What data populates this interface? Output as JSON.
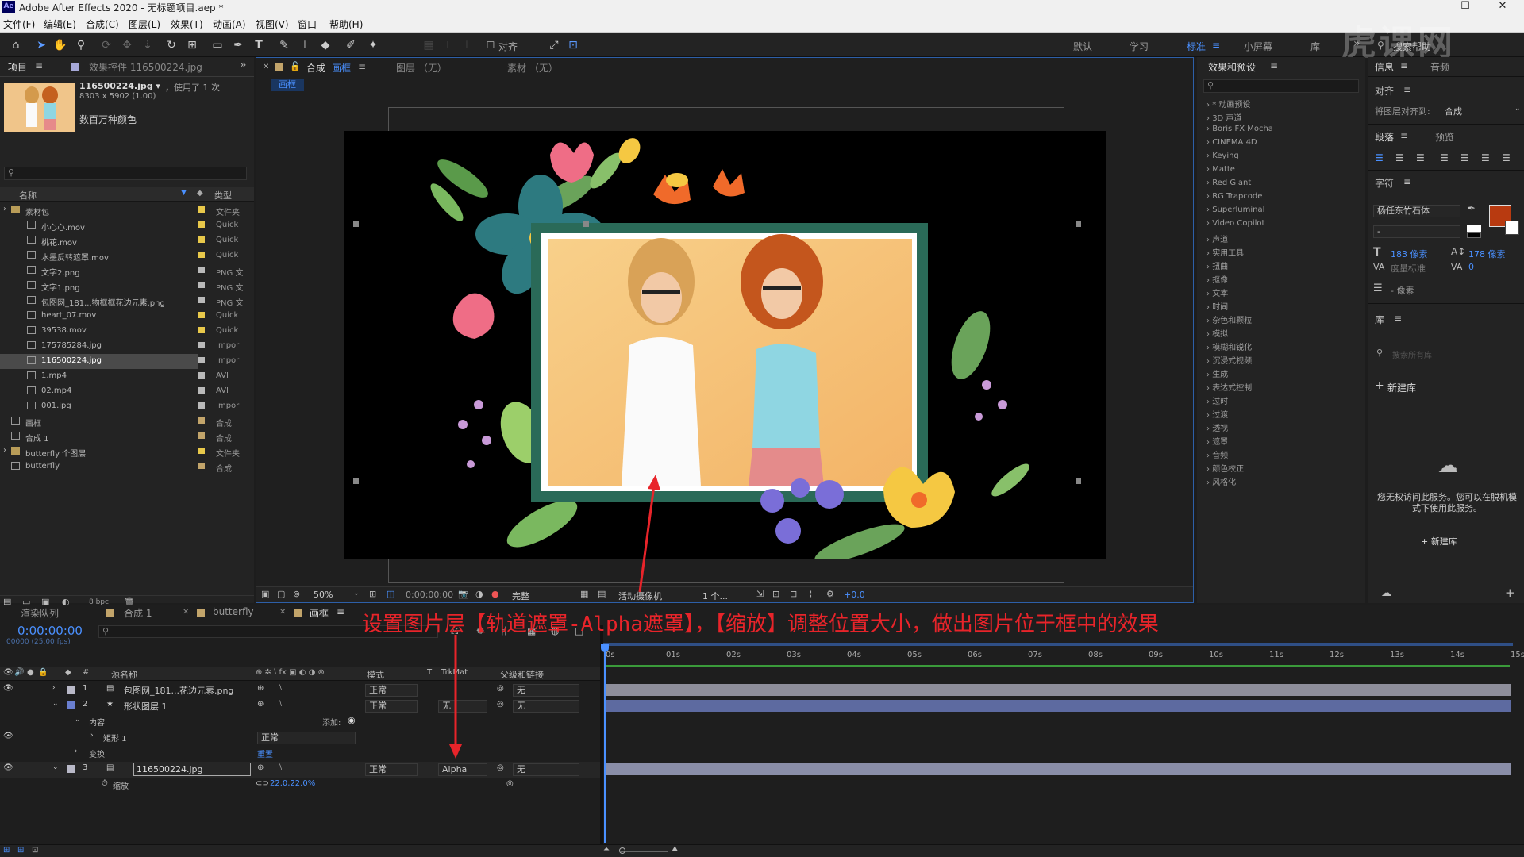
{
  "app": {
    "title": "Adobe After Effects 2020 - 无标题项目.aep *",
    "logo": "Ae"
  },
  "window_controls": {
    "minimize": "—",
    "maximize": "☐",
    "close": "✕"
  },
  "menu": [
    "文件(F)",
    "编辑(E)",
    "合成(C)",
    "图层(L)",
    "效果(T)",
    "动画(A)",
    "视图(V)",
    "窗口",
    "帮助(H)"
  ],
  "toolbar": {
    "snap_label": "对齐",
    "workspaces": [
      "默认",
      "学习",
      "标准",
      "小屏幕",
      "库"
    ],
    "more": "»",
    "search_help": "搜索帮助"
  },
  "watermark": "虎课网",
  "project": {
    "tab": "项目",
    "effect_controls": "效果控件 116500224.jpg",
    "file_name": "116500224.jpg ▾",
    "usage": "，使用了 1 次",
    "dimensions": "8303 x 5902 (1.00)",
    "description": "数百万种颜色",
    "col_name": "名称",
    "col_type": "类型",
    "bpc": "8 bpc",
    "items": [
      {
        "name": "素材包",
        "type": "文件夹",
        "color": "#e8c84a",
        "indent": 0,
        "folder": true
      },
      {
        "name": "小心心.mov",
        "type": "Quick",
        "color": "#e8c84a",
        "indent": 1
      },
      {
        "name": "桃花.mov",
        "type": "Quick",
        "color": "#e8c84a",
        "indent": 1
      },
      {
        "name": "水墨反转遮罩.mov",
        "type": "Quick",
        "color": "#e8c84a",
        "indent": 1
      },
      {
        "name": "文字2.png",
        "type": "PNG 文",
        "color": "#b9b9b9",
        "indent": 1
      },
      {
        "name": "文字1.png",
        "type": "PNG 文",
        "color": "#b9b9b9",
        "indent": 1
      },
      {
        "name": "包图网_181...物框框花边元素.png",
        "type": "PNG 文",
        "color": "#b9b9b9",
        "indent": 1
      },
      {
        "name": "heart_07.mov",
        "type": "Quick",
        "color": "#e8c84a",
        "indent": 1
      },
      {
        "name": "39538.mov",
        "type": "Quick",
        "color": "#e8c84a",
        "indent": 1
      },
      {
        "name": "175785284.jpg",
        "type": "Impor",
        "color": "#b9b9b9",
        "indent": 1
      },
      {
        "name": "116500224.jpg",
        "type": "Impor",
        "color": "#b9b9b9",
        "indent": 1,
        "selected": true
      },
      {
        "name": "1.mp4",
        "type": "AVI",
        "color": "#b9b9b9",
        "indent": 1
      },
      {
        "name": "02.mp4",
        "type": "AVI",
        "color": "#b9b9b9",
        "indent": 1
      },
      {
        "name": "001.jpg",
        "type": "Impor",
        "color": "#b9b9b9",
        "indent": 1
      },
      {
        "name": "画框",
        "type": "合成",
        "color": "#c2a46a",
        "indent": 0
      },
      {
        "name": "合成 1",
        "type": "合成",
        "color": "#c2a46a",
        "indent": 0
      },
      {
        "name": "butterfly 个图层",
        "type": "文件夹",
        "color": "#e8c84a",
        "indent": 0,
        "folder": true
      },
      {
        "name": "butterfly",
        "type": "合成",
        "color": "#c2a46a",
        "indent": 0
      }
    ]
  },
  "comp_viewer": {
    "tab": "合成",
    "tab_name": "画框",
    "layer_tab": "图层 （无）",
    "footage_tab": "素材 （无）",
    "sub_tab": "画框",
    "zoom": "50%",
    "timecode": "0:00:00:00",
    "resolution": "完整",
    "camera": "活动摄像机",
    "views": "1 个...",
    "exposure": "+0.0"
  },
  "effects": {
    "title": "效果和预设",
    "items": [
      "* 动画预设",
      "3D 声道",
      "Boris FX Mocha",
      "CINEMA 4D",
      "Keying",
      "Matte",
      "Red Giant",
      "RG Trapcode",
      "Superluminal",
      "Video Copilot",
      "声道",
      "实用工具",
      "扭曲",
      "抠像",
      "文本",
      "时间",
      "杂色和颗粒",
      "模拟",
      "模糊和锐化",
      "沉浸式视频",
      "生成",
      "表达式控制",
      "过时",
      "过渡",
      "透视",
      "遮罩",
      "音频",
      "颜色校正",
      "风格化"
    ]
  },
  "right_panels": {
    "info_tab": "信息",
    "audio_tab": "音频",
    "align_title": "对齐",
    "align_to_label": "将图层对齐到:",
    "align_to_value": "合成",
    "paragraph_tab": "段落",
    "preview_tab": "预览",
    "character_title": "字符",
    "font_name": "杨任东竹石体",
    "font_style": "-",
    "font_size": "183 像素",
    "leading": "178 像素",
    "kerning": "度量标准",
    "tracking": "0",
    "stroke_width": "- 像素",
    "library_title": "库",
    "library_search": "搜索所有库",
    "new_library": "新建库",
    "cloud_message": "您无权访问此服务。您可以在脱机模式下使用此服务。",
    "new_library_button": "+ 新建库",
    "text_color": "#b83a10"
  },
  "timeline": {
    "tabs": [
      "渲染队列",
      "合成 1",
      "butterfly",
      "画框"
    ],
    "timecode": "0:00:00:00",
    "frame_info": "00000 (25.00 fps)",
    "ruler": [
      "0s",
      "01s",
      "02s",
      "03s",
      "04s",
      "05s",
      "06s",
      "07s",
      "08s",
      "09s",
      "10s",
      "11s",
      "12s",
      "13s",
      "14s",
      "15s"
    ],
    "col_source": "源名称",
    "col_mode": "模式",
    "col_t": "T",
    "col_trkmat": "TrkMat",
    "col_parent": "父级和链接",
    "layers": [
      {
        "num": "1",
        "name": "包图网_181...花边元素.png",
        "mode": "正常",
        "trkmat": "",
        "parent": "无",
        "color": "#b9b9c8"
      },
      {
        "num": "2",
        "name": "形状图层 1",
        "mode": "正常",
        "trkmat": "无",
        "parent": "无",
        "color": "#6a7fd0"
      },
      {
        "num": "3",
        "name": "116500224.jpg",
        "mode": "正常",
        "trkmat": "Alpha",
        "parent": "无",
        "color": "#b9b9c8"
      }
    ],
    "contents_label": "内容",
    "add_label": "添加:",
    "rect_label": "矩形 1",
    "rect_mode": "正常",
    "transform_label": "变换",
    "reset_label": "重置",
    "scale_label": "缩放",
    "scale_value": "22.0,22.0%"
  },
  "annotation": "设置图片层【轨道遮罩-Alpha遮罩】，【缩放】调整位置大小，做出图片位于框中的效果"
}
